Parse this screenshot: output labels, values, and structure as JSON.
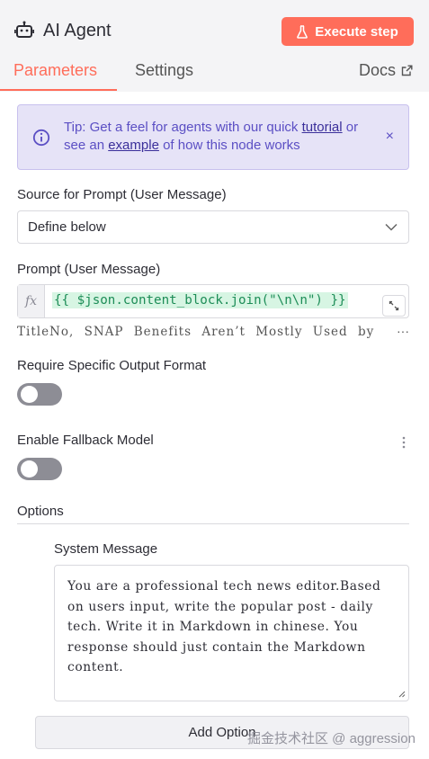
{
  "header": {
    "title": "AI Agent",
    "execute_label": "Execute step"
  },
  "tabs": [
    {
      "label": "Parameters",
      "active": true
    },
    {
      "label": "Settings",
      "active": false
    },
    {
      "label": "Docs",
      "active": false
    }
  ],
  "tip": {
    "prefix": "Tip: Get a feel for agents with our quick ",
    "link1": "tutorial",
    "middle": " or see an ",
    "link2": "example",
    "suffix": " of how this node works",
    "close": "×"
  },
  "source": {
    "label": "Source for Prompt (User Message)",
    "value": "Define below"
  },
  "prompt": {
    "label": "Prompt (User Message)",
    "fx": "fx",
    "expression": "{{ $json.content_block.join(\"\\n\\n\") }}",
    "preview": "TitleNo, SNAP Benefits Aren’t Mostly Used by",
    "preview_more": "···"
  },
  "output_format": {
    "label": "Require Specific Output Format",
    "enabled": false
  },
  "fallback": {
    "label": "Enable Fallback Model",
    "enabled": false
  },
  "options": {
    "label": "Options",
    "system_message_label": "System Message",
    "system_message": "You are a professional tech news editor.Based on users input, write the popular post - daily tech. Write it in Markdown in chinese. You response should just contain the Markdown content.",
    "add_option": "Add Option"
  },
  "watermark": "掘金技术社区 @ aggression",
  "colors": {
    "accent": "#ff6d5a",
    "tip_bg": "#e6e3f7",
    "tip_text": "#5b4fc4",
    "expr_bg": "#d7f5e3",
    "expr_text": "#1d8d57",
    "toggle_off": "#8d8d95"
  },
  "icons": {
    "title": "robot-icon",
    "execute": "flask-icon",
    "docs": "external-link-icon",
    "tip": "info-icon",
    "select": "chevron-down-icon",
    "expand": "expand-icon",
    "fallback_menu": "kebab-icon",
    "textarea": "resize-grip-icon"
  }
}
